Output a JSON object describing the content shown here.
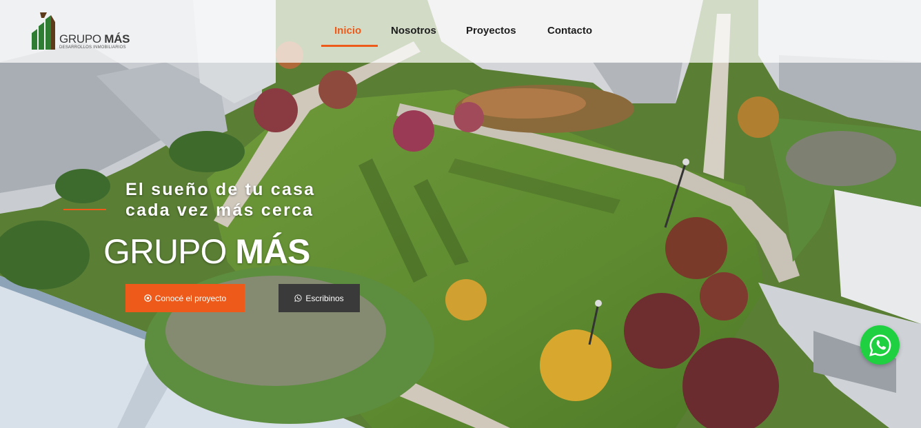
{
  "logo": {
    "title_light": "GRUPO",
    "title_bold": "MÁS",
    "subtitle": "DESARROLLOS INMOBILIARIOS"
  },
  "nav": {
    "items": [
      {
        "label": "Inicio",
        "active": true
      },
      {
        "label": "Nosotros",
        "active": false
      },
      {
        "label": "Proyectos",
        "active": false
      },
      {
        "label": "Contacto",
        "active": false
      }
    ]
  },
  "hero": {
    "tagline_line1": "El sueño de tu casa",
    "tagline_line2": "cada vez más cerca",
    "brand_light": "GRUPO",
    "brand_bold": "MÁS",
    "primary_button": {
      "label": "Conocé el proyecto",
      "icon": "circle-dot-icon"
    },
    "secondary_button": {
      "label": "Escribinos",
      "icon": "whatsapp-icon"
    }
  },
  "whatsapp_fab": {
    "icon": "whatsapp-icon"
  },
  "colors": {
    "accent": "#ee5a1a",
    "dark_button": "#3a3a3a",
    "whatsapp": "#1fd041",
    "logo_green": "#2e7d32",
    "logo_brown": "#5d3a1a"
  }
}
